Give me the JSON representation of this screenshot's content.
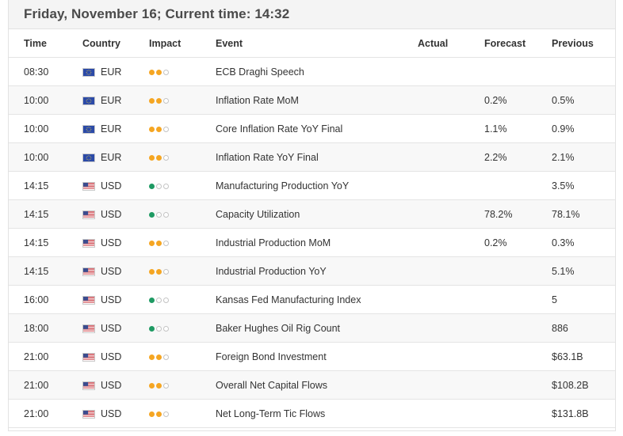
{
  "header": {
    "title": "Friday, November 16; Current time: 14:32"
  },
  "columns": {
    "time": "Time",
    "country": "Country",
    "impact": "Impact",
    "event": "Event",
    "actual": "Actual",
    "forecast": "Forecast",
    "previous": "Previous"
  },
  "colors": {
    "impact_medium": "#f5a623",
    "impact_low": "#1e9a63"
  },
  "rows": [
    {
      "time": "08:30",
      "country": "EUR",
      "flag": "eu-flag-icon",
      "impact": 2,
      "impact_color": "orange",
      "event": "ECB Draghi Speech",
      "actual": "",
      "forecast": "",
      "previous": ""
    },
    {
      "time": "10:00",
      "country": "EUR",
      "flag": "eu-flag-icon",
      "impact": 2,
      "impact_color": "orange",
      "event": "Inflation Rate MoM",
      "actual": "",
      "forecast": "0.2%",
      "previous": "0.5%"
    },
    {
      "time": "10:00",
      "country": "EUR",
      "flag": "eu-flag-icon",
      "impact": 2,
      "impact_color": "orange",
      "event": "Core Inflation Rate YoY Final",
      "actual": "",
      "forecast": "1.1%",
      "previous": "0.9%"
    },
    {
      "time": "10:00",
      "country": "EUR",
      "flag": "eu-flag-icon",
      "impact": 2,
      "impact_color": "orange",
      "event": "Inflation Rate YoY Final",
      "actual": "",
      "forecast": "2.2%",
      "previous": "2.1%"
    },
    {
      "time": "14:15",
      "country": "USD",
      "flag": "us-flag-icon",
      "impact": 1,
      "impact_color": "green",
      "event": "Manufacturing Production YoY",
      "actual": "",
      "forecast": "",
      "previous": "3.5%"
    },
    {
      "time": "14:15",
      "country": "USD",
      "flag": "us-flag-icon",
      "impact": 1,
      "impact_color": "green",
      "event": "Capacity Utilization",
      "actual": "",
      "forecast": "78.2%",
      "previous": "78.1%"
    },
    {
      "time": "14:15",
      "country": "USD",
      "flag": "us-flag-icon",
      "impact": 2,
      "impact_color": "orange",
      "event": "Industrial Production MoM",
      "actual": "",
      "forecast": "0.2%",
      "previous": "0.3%"
    },
    {
      "time": "14:15",
      "country": "USD",
      "flag": "us-flag-icon",
      "impact": 2,
      "impact_color": "orange",
      "event": "Industrial Production YoY",
      "actual": "",
      "forecast": "",
      "previous": "5.1%"
    },
    {
      "time": "16:00",
      "country": "USD",
      "flag": "us-flag-icon",
      "impact": 1,
      "impact_color": "green",
      "event": "Kansas Fed Manufacturing Index",
      "actual": "",
      "forecast": "",
      "previous": "5"
    },
    {
      "time": "18:00",
      "country": "USD",
      "flag": "us-flag-icon",
      "impact": 1,
      "impact_color": "green",
      "event": "Baker Hughes Oil Rig Count",
      "actual": "",
      "forecast": "",
      "previous": "886"
    },
    {
      "time": "21:00",
      "country": "USD",
      "flag": "us-flag-icon",
      "impact": 2,
      "impact_color": "orange",
      "event": "Foreign Bond Investment",
      "actual": "",
      "forecast": "",
      "previous": "$63.1B"
    },
    {
      "time": "21:00",
      "country": "USD",
      "flag": "us-flag-icon",
      "impact": 2,
      "impact_color": "orange",
      "event": "Overall Net Capital Flows",
      "actual": "",
      "forecast": "",
      "previous": "$108.2B"
    },
    {
      "time": "21:00",
      "country": "USD",
      "flag": "us-flag-icon",
      "impact": 2,
      "impact_color": "orange",
      "event": "Net Long-Term Tic Flows",
      "actual": "",
      "forecast": "",
      "previous": "$131.8B"
    }
  ]
}
